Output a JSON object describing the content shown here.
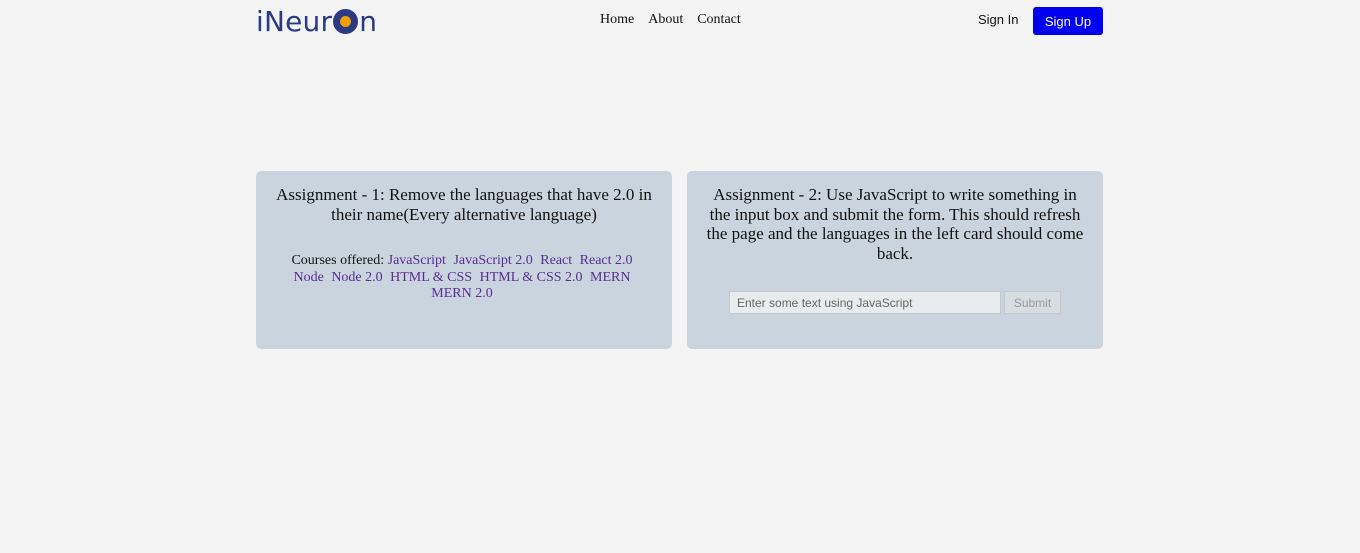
{
  "header": {
    "logo_prefix": "iNeur",
    "logo_suffix": "n",
    "nav": [
      {
        "label": "Home"
      },
      {
        "label": "About"
      },
      {
        "label": "Contact"
      }
    ],
    "sign_in": "Sign In",
    "sign_up": "Sign Up"
  },
  "assignment1": {
    "title": "Assignment - 1: Remove the languages that have 2.0 in their name(Every alternative language)",
    "courses_label": "Courses offered:",
    "languages": [
      "JavaScript",
      "JavaScript 2.0",
      "React",
      "React 2.0",
      "Node",
      "Node 2.0",
      "HTML & CSS",
      "HTML & CSS 2.0",
      "MERN",
      "MERN 2.0"
    ]
  },
  "assignment2": {
    "title": "Assignment - 2: Use JavaScript to write something in the input box and submit the form. This should refresh the page and the languages in the left card should come back.",
    "input_placeholder": "Enter some text using JavaScript",
    "submit_label": "Submit"
  },
  "colors": {
    "brand": "#2b3a82",
    "accent": "#0000ee",
    "card_bg": "#c9d4df",
    "link": "#5a2d91"
  }
}
